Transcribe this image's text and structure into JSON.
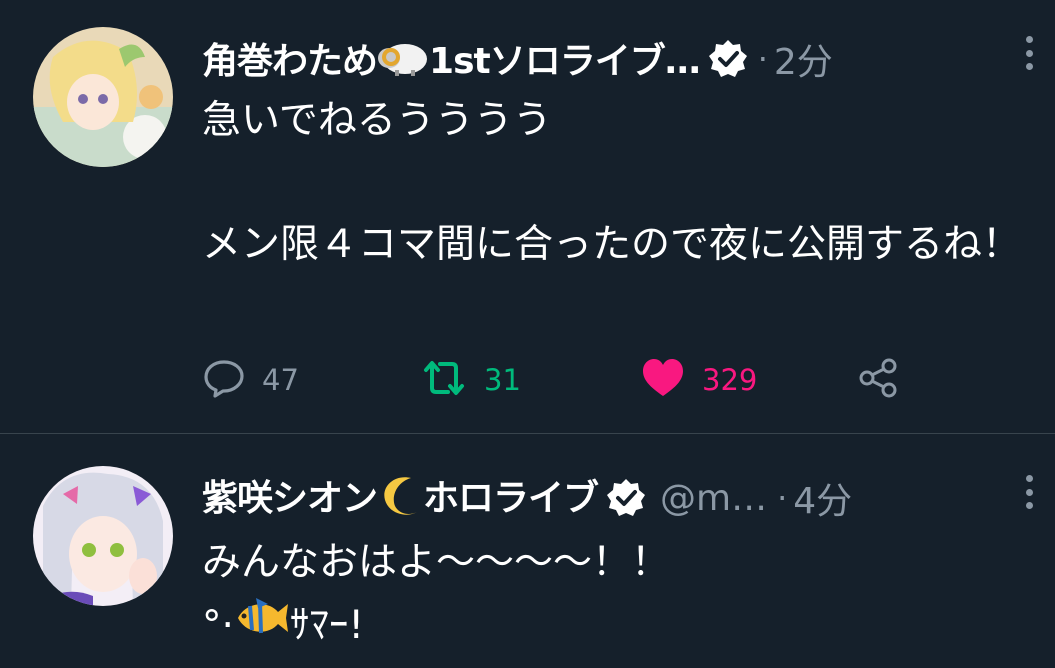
{
  "tweets": [
    {
      "name_prefix": "角巻わため",
      "name_emoji": "sheep-icon",
      "name_suffix": "1stソロライブ…",
      "handle": "",
      "dot": "·",
      "time": "2分",
      "text": "急いでねるうううう\n\nメン限４コマ間に合ったので夜に公開するね！",
      "reply_count": "47",
      "retweet_count": "31",
      "like_count": "329",
      "liked": true,
      "retweeted": true
    },
    {
      "name_prefix": "紫咲シオン",
      "name_emoji": "crescent-moon-icon",
      "name_suffix": "ホロライブ",
      "handle": "@m…",
      "dot": "·",
      "time": "4分",
      "text_line1": "みんなおはよ〜〜〜〜！！",
      "text_prefix": "°·",
      "text_emoji": "tropical-fish-icon",
      "text_suffix": "ｻﾏｰ!"
    }
  ],
  "colors": {
    "background": "#15202b",
    "text": "#ffffff",
    "secondary": "#8b98a5",
    "retweet_green": "#00ba7c",
    "like_pink": "#f91880",
    "divider": "#38444d"
  }
}
